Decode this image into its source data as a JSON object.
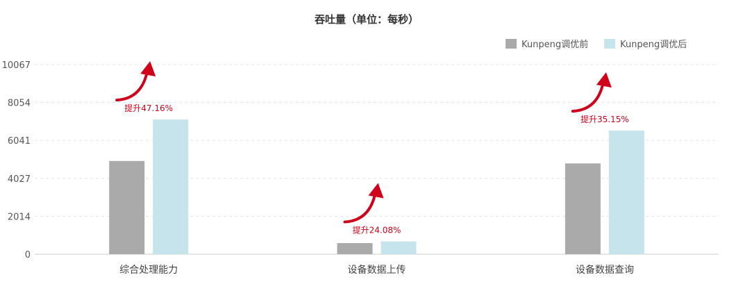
{
  "chart_data": {
    "type": "bar",
    "title": "吞吐量（单位：每秒）",
    "categories": [
      "综合处理能力",
      "设备数据上传",
      "设备数据查询"
    ],
    "series": [
      {
        "name": "Kunpeng调优前",
        "color": "#aaaaaa",
        "values": [
          4950,
          590,
          4820
        ]
      },
      {
        "name": "Kunpeng调优后",
        "color": "#c6e4ec",
        "values": [
          7150,
          680,
          6560
        ]
      }
    ],
    "y_ticks": [
      "0",
      "2014",
      "4027",
      "6041",
      "8054",
      "10067"
    ],
    "ylim": [
      0,
      10067
    ],
    "legend_position": "top-right",
    "grid": "horizontal-dashed",
    "annotations": [
      {
        "category_index": 0,
        "text": "提升47.16%"
      },
      {
        "category_index": 1,
        "text": "提升24.08%"
      },
      {
        "category_index": 2,
        "text": "提升35.15%"
      }
    ],
    "annotation_color": "#d0021b"
  }
}
